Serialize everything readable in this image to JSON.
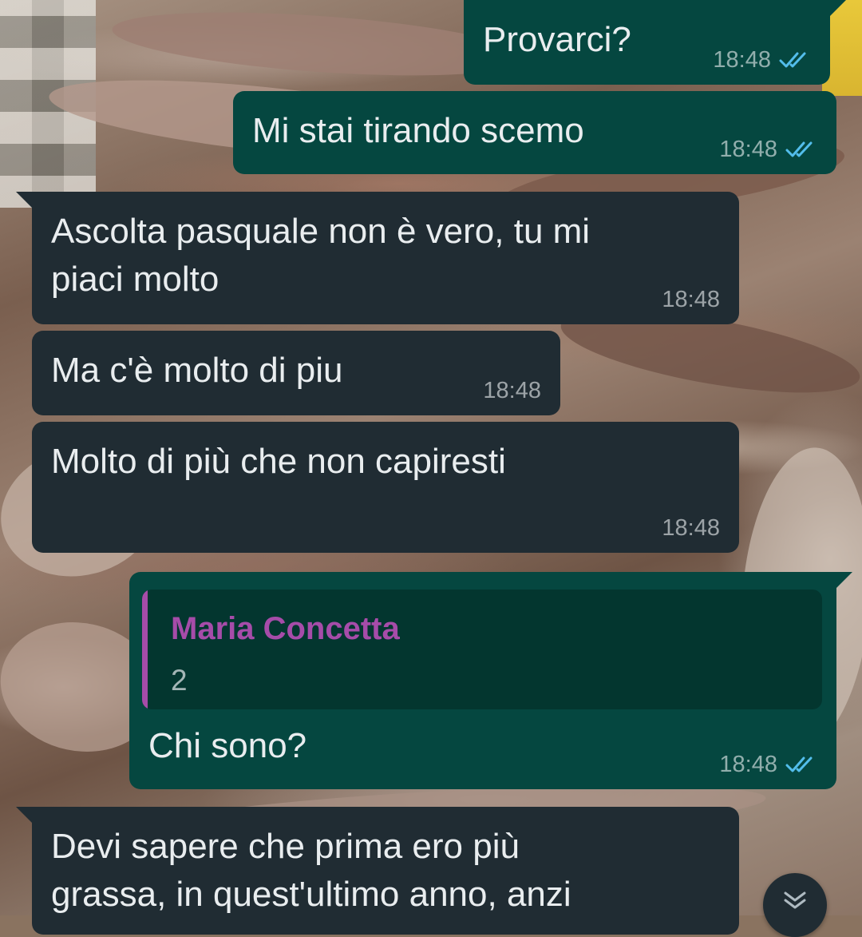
{
  "theme": {
    "outgoing_bubble": "#054740",
    "incoming_bubble": "#202c33",
    "text_color": "#e9edef",
    "tick_read_color": "#53bdeb",
    "quote_author_color": "#a64ca9"
  },
  "messages": [
    {
      "direction": "outgoing",
      "text": "Provarci?",
      "time": "18:48",
      "status_icon": "double-check-read-icon"
    },
    {
      "direction": "outgoing",
      "text": "Mi stai tirando scemo",
      "time": "18:48",
      "status_icon": "double-check-read-icon"
    },
    {
      "direction": "incoming",
      "lines": [
        "Ascolta pasquale non è vero, tu mi",
        "piaci molto"
      ],
      "time": "18:48"
    },
    {
      "direction": "incoming",
      "text": "Ma c'è molto di piu",
      "time": "18:48"
    },
    {
      "direction": "incoming",
      "text": "Molto di più che non capiresti",
      "time": "18:48"
    },
    {
      "direction": "outgoing",
      "reply_to": {
        "author": "Maria Concetta",
        "text": "2"
      },
      "text": "Chi sono?",
      "time": "18:48",
      "status_icon": "double-check-read-icon"
    },
    {
      "direction": "incoming",
      "lines": [
        "Devi sapere che prima ero più",
        "grassa, in quest'ultimo anno, anzi"
      ]
    }
  ],
  "scroll_button": {
    "icon": "double-chevron-down-icon"
  }
}
